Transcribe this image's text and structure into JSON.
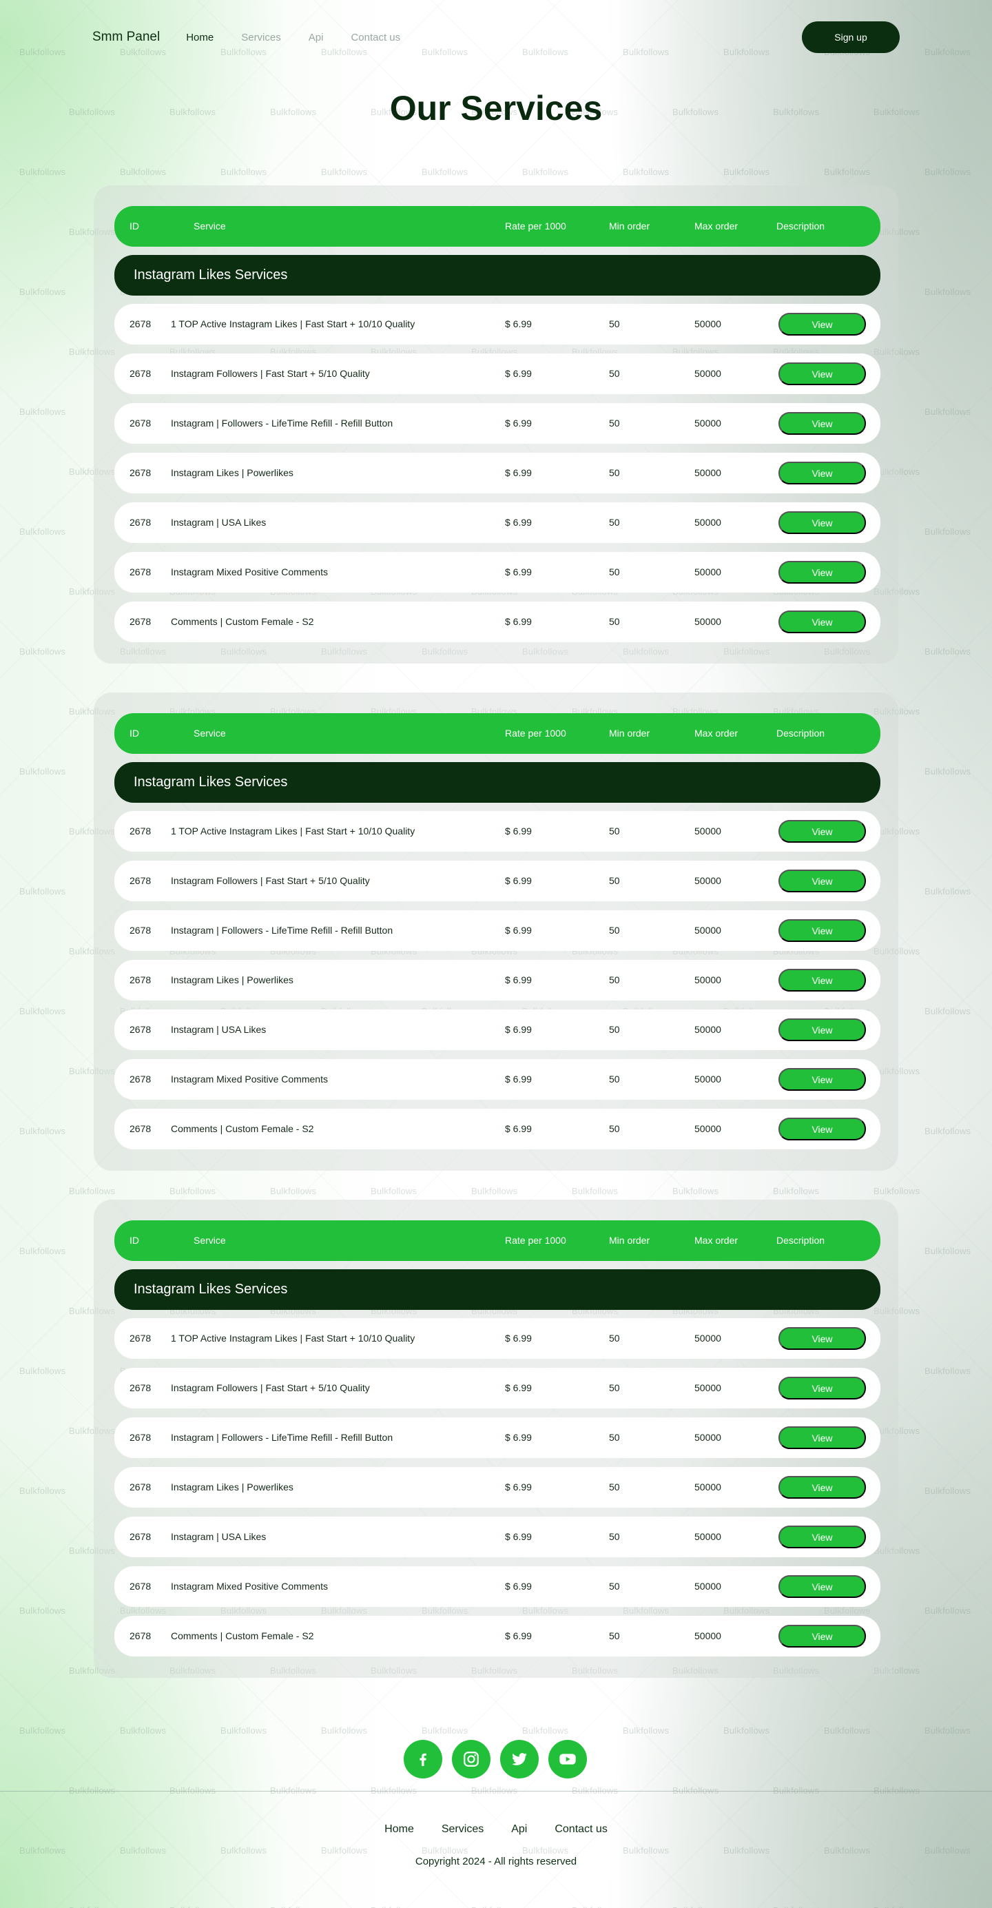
{
  "nav": {
    "brand": "Smm Panel",
    "links": [
      "Home",
      "Services",
      "Api",
      "Contact us"
    ],
    "signup_label": "Sign up"
  },
  "page_title": "Our Services",
  "watermark_text": "Bulkfollows",
  "table_header": {
    "id": "ID",
    "service": "Service",
    "rate": "Rate per 1000",
    "min": "Min order",
    "max": "Max order",
    "description": "Description"
  },
  "tables": [
    {
      "category": "Instagram Likes Services",
      "rows": [
        {
          "id": "2678",
          "service": "1 TOP Active Instagram Likes | Fast Start + 10/10 Quality",
          "rate": "$ 6.99",
          "min": "50",
          "max": "50000",
          "action": "View"
        },
        {
          "id": "2678",
          "service": "Instagram Followers | Fast Start + 5/10 Quality",
          "rate": "$ 6.99",
          "min": "50",
          "max": "50000",
          "action": "View"
        },
        {
          "id": "2678",
          "service": "Instagram | Followers - LifeTime Refill - Refill Button",
          "rate": "$ 6.99",
          "min": "50",
          "max": "50000",
          "action": "View"
        },
        {
          "id": "2678",
          "service": "Instagram Likes | Powerlikes",
          "rate": "$ 6.99",
          "min": "50",
          "max": "50000",
          "action": "View"
        },
        {
          "id": "2678",
          "service": "Instagram | USA Likes",
          "rate": "$ 6.99",
          "min": "50",
          "max": "50000",
          "action": "View"
        },
        {
          "id": "2678",
          "service": "Instagram Mixed Positive Comments",
          "rate": "$ 6.99",
          "min": "50",
          "max": "50000",
          "action": "View"
        },
        {
          "id": "2678",
          "service": "Comments | Custom Female - S2",
          "rate": "$ 6.99",
          "min": "50",
          "max": "50000",
          "action": "View"
        }
      ]
    },
    {
      "category": "Instagram Likes Services",
      "rows": [
        {
          "id": "2678",
          "service": "1 TOP Active Instagram Likes | Fast Start + 10/10 Quality",
          "rate": "$ 6.99",
          "min": "50",
          "max": "50000",
          "action": "View"
        },
        {
          "id": "2678",
          "service": "Instagram Followers | Fast Start + 5/10 Quality",
          "rate": "$ 6.99",
          "min": "50",
          "max": "50000",
          "action": "View"
        },
        {
          "id": "2678",
          "service": "Instagram | Followers - LifeTime Refill - Refill Button",
          "rate": "$ 6.99",
          "min": "50",
          "max": "50000",
          "action": "View"
        },
        {
          "id": "2678",
          "service": "Instagram Likes | Powerlikes",
          "rate": "$ 6.99",
          "min": "50",
          "max": "50000",
          "action": "View"
        },
        {
          "id": "2678",
          "service": "Instagram | USA Likes",
          "rate": "$ 6.99",
          "min": "50",
          "max": "50000",
          "action": "View"
        },
        {
          "id": "2678",
          "service": "Instagram Mixed Positive Comments",
          "rate": "$ 6.99",
          "min": "50",
          "max": "50000",
          "action": "View"
        },
        {
          "id": "2678",
          "service": "Comments | Custom Female - S2",
          "rate": "$ 6.99",
          "min": "50",
          "max": "50000",
          "action": "View"
        }
      ]
    },
    {
      "category": "Instagram Likes Services",
      "rows": [
        {
          "id": "2678",
          "service": "1 TOP Active Instagram Likes | Fast Start + 10/10 Quality",
          "rate": "$ 6.99",
          "min": "50",
          "max": "50000",
          "action": "View"
        },
        {
          "id": "2678",
          "service": "Instagram Followers | Fast Start + 5/10 Quality",
          "rate": "$ 6.99",
          "min": "50",
          "max": "50000",
          "action": "View"
        },
        {
          "id": "2678",
          "service": "Instagram | Followers - LifeTime Refill - Refill Button",
          "rate": "$ 6.99",
          "min": "50",
          "max": "50000",
          "action": "View"
        },
        {
          "id": "2678",
          "service": "Instagram Likes | Powerlikes",
          "rate": "$ 6.99",
          "min": "50",
          "max": "50000",
          "action": "View"
        },
        {
          "id": "2678",
          "service": "Instagram | USA Likes",
          "rate": "$ 6.99",
          "min": "50",
          "max": "50000",
          "action": "View"
        },
        {
          "id": "2678",
          "service": "Instagram Mixed Positive Comments",
          "rate": "$ 6.99",
          "min": "50",
          "max": "50000",
          "action": "View"
        },
        {
          "id": "2678",
          "service": "Comments | Custom Female - S2",
          "rate": "$ 6.99",
          "min": "50",
          "max": "50000",
          "action": "View"
        }
      ]
    }
  ],
  "footer": {
    "socials": [
      "facebook-icon",
      "instagram-icon",
      "twitter-icon",
      "youtube-icon"
    ],
    "links": [
      "Home",
      "Services",
      "Api",
      "Contact us"
    ],
    "copyright": "Copyright 2024 - All rights reserved"
  },
  "colors": {
    "accent_green": "#22c03a",
    "dark_green": "#0a2e0f"
  }
}
